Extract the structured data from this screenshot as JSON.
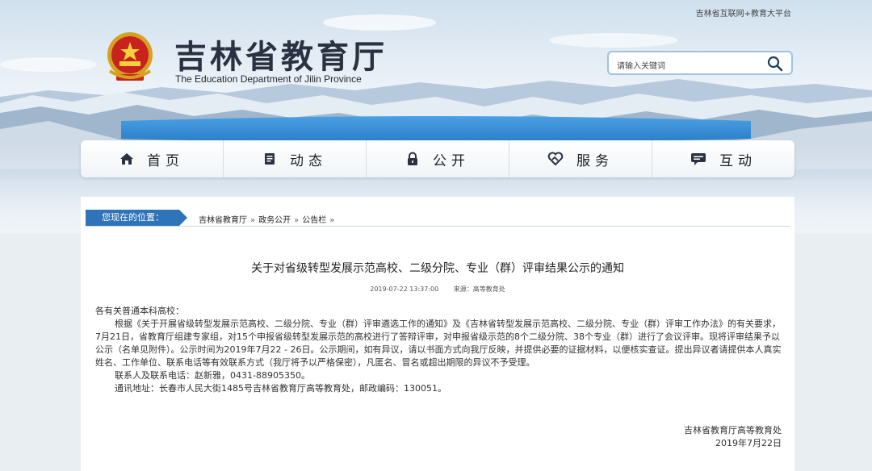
{
  "top_links": "吉林省互联网+教育大平台",
  "logo": {
    "cn": "吉林省教育厅",
    "en": "The Education Department of Jilin Province"
  },
  "search": {
    "placeholder": "请输入关键词"
  },
  "nav": [
    {
      "label": "首页",
      "icon": "home-icon"
    },
    {
      "label": "动态",
      "icon": "document-icon"
    },
    {
      "label": "公开",
      "icon": "lock-icon"
    },
    {
      "label": "服务",
      "icon": "handshake-heart-icon"
    },
    {
      "label": "互动",
      "icon": "chat-icon"
    }
  ],
  "breadcrumb": {
    "lead": "您现在的位置：",
    "items": [
      "吉林省教育厅",
      "政务公开",
      "公告栏"
    ],
    "sep": "»"
  },
  "article": {
    "title": "关于对省级转型发展示范高校、二级分院、专业（群）评审结果公示的通知",
    "date": "2019-07-22 13:37:00",
    "source": "来源：高等教育处",
    "greeting": "各有关普通本科高校：",
    "p1": "根据《关于开展省级转型发展示范高校、二级分院、专业（群）评审遴选工作的通知》及《吉林省转型发展示范高校、二级分院、专业（群）评审工作办法》的有关要求，7月21日，省教育厅组建专家组，对15个申报省级转型发展示范的高校进行了答辩评审，对申报省级示范的8个二级分院、38个专业（群）进行了会议评审。现将评审结果予以公示（名单见附件）。公示时间为2019年7月22 - 26日。公示期间，如有异议，请以书面方式向我厅反映，并提供必要的证据材料，以便核实查证。提出异议者请提供本人真实姓名、工作单位、联系电话等有效联系方式（我厅将予以严格保密），凡匿名、冒名或超出期限的异议不予受理。",
    "contact": "联系人及联系电话：赵新雅，0431-88905350。",
    "address": "通讯地址：长春市人民大街1485号吉林省教育厅高等教育处，邮政编码：130051。",
    "sign_org": "吉林省教育厅高等教育处",
    "sign_date": "2019年7月22日"
  },
  "colors": {
    "accent": "#2f73b8",
    "lake": "#3a8fd6"
  }
}
